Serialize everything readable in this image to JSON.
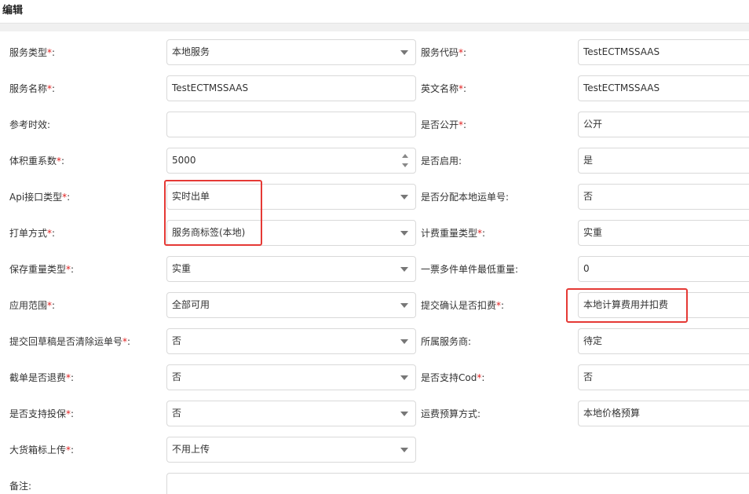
{
  "header": {
    "title": "编辑"
  },
  "colors": {
    "required": "#e02020",
    "highlight": "#e53935"
  },
  "left": {
    "service_type": {
      "label": "服务类型",
      "value": "本地服务"
    },
    "service_name": {
      "label": "服务名称",
      "value": "TestECTMSSAAS"
    },
    "ref_time": {
      "label": "参考时效",
      "value": ""
    },
    "volume_factor": {
      "label": "体积重系数",
      "value": "5000"
    },
    "api_type": {
      "label": "Api接口类型",
      "value": "实时出单"
    },
    "print_method": {
      "label": "打单方式",
      "value": "服务商标签(本地)"
    },
    "save_weight_type": {
      "label": "保存重量类型",
      "value": "实重"
    },
    "scope": {
      "label": "应用范围",
      "value": "全部可用"
    },
    "clear_tracking": {
      "label": "提交回草稿是否清除运单号",
      "value": "否"
    },
    "cut_refund": {
      "label": "截单是否退费",
      "value": "否"
    },
    "insurance": {
      "label": "是否支持投保",
      "value": "否"
    },
    "big_box_upload": {
      "label": "大货箱标上传",
      "value": "不用上传"
    },
    "remark": {
      "label": "备注"
    }
  },
  "right": {
    "service_code": {
      "label": "服务代码",
      "value": "TestECTMSSAAS"
    },
    "english_name": {
      "label": "英文名称",
      "value": "TestECTMSSAAS"
    },
    "is_public": {
      "label": "是否公开",
      "value": "公开"
    },
    "is_enabled": {
      "label": "是否启用",
      "value": "是"
    },
    "alloc_tracking": {
      "label": "是否分配本地运单号",
      "value": "否"
    },
    "charge_weight_type": {
      "label": "计费重量类型",
      "value": "实重"
    },
    "min_weight": {
      "label": "一票多件单件最低重量",
      "value": "0"
    },
    "submit_deduct": {
      "label": "提交确认是否扣费",
      "value": "本地计算费用并扣费"
    },
    "provider": {
      "label": "所属服务商",
      "value": "待定"
    },
    "support_cod": {
      "label": "是否支持Cod",
      "value": "否"
    },
    "freight_budget": {
      "label": "运费预算方式",
      "value": "本地价格预算"
    }
  }
}
